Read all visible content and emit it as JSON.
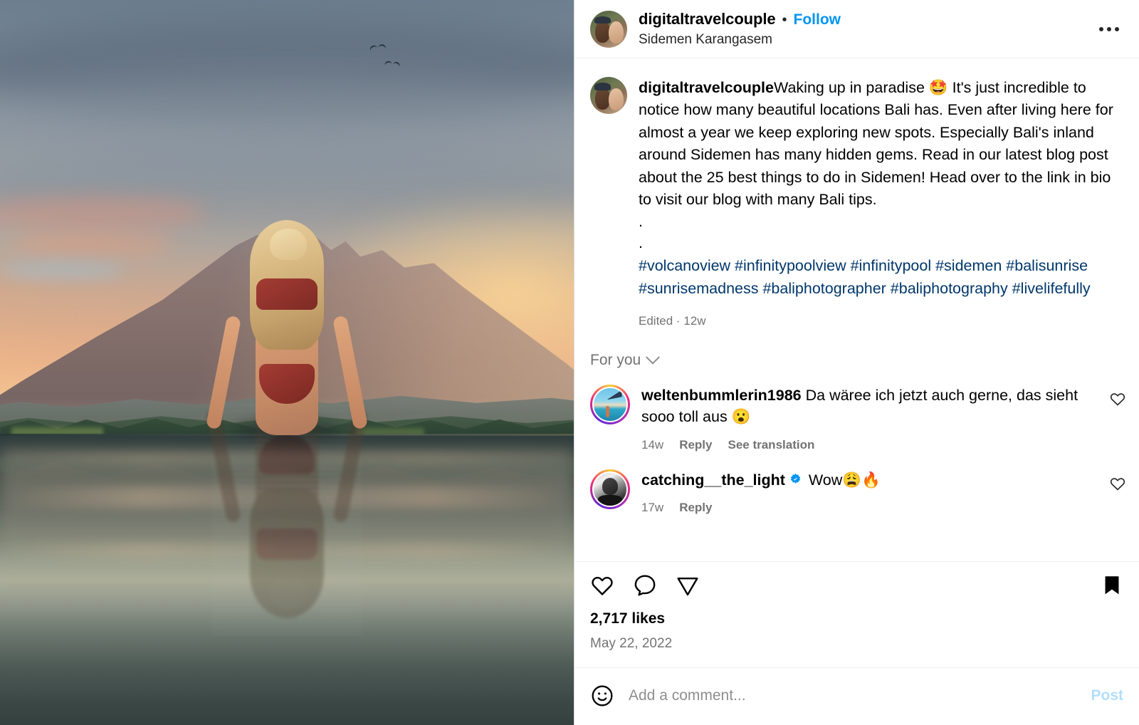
{
  "header": {
    "username": "digitaltravelcouple",
    "separator": "•",
    "follow_label": "Follow",
    "location": "Sidemen Karangasem",
    "more_icon": "ellipsis-icon",
    "avatar_alt": "digitaltravelcouple-avatar"
  },
  "caption": {
    "username": "digitaltravelcouple",
    "body": "Waking up in paradise 🤩 It's just incredible to notice how many beautiful locations Bali has. Even after living here for almost a year we keep exploring new spots. Especially Bali's inland around Sidemen has many hidden gems. Read in our latest blog post about the 25 best things to do in Sidemen! Head over to the link in bio to visit our blog with many Bali tips.",
    "dot_line_1": ".",
    "dot_line_2": ".",
    "hashtags": "#volcanoview #infinitypoolview #infinitypool #sidemen #balisunrise #sunrisemadness #baliphotographer #baliphotography #livelifefully",
    "edited_meta": "Edited · 12w"
  },
  "comments_filter": {
    "label": "For you",
    "chevron_icon": "chevron-down-icon"
  },
  "comments": [
    {
      "username": "weltenbummlerin1986",
      "verified": false,
      "text": " Da wäree ich jetzt auch gerne, das sieht sooo toll aus 😮",
      "time": "14w",
      "reply_label": "Reply",
      "translate_label": "See translation",
      "like_icon": "heart-outline-icon",
      "avatar_alt": "weltenbummlerin1986-avatar"
    },
    {
      "username": "catching__the_light",
      "verified": true,
      "text": " Wow😩🔥",
      "time": "17w",
      "reply_label": "Reply",
      "translate_label": "",
      "like_icon": "heart-outline-icon",
      "avatar_alt": "catching__the_light-avatar"
    }
  ],
  "actions": {
    "like_icon": "heart-outline-icon",
    "comment_icon": "comment-bubble-icon",
    "share_icon": "share-paper-plane-icon",
    "save_icon": "bookmark-filled-icon",
    "likes": "2,717 likes",
    "date": "May 22, 2022"
  },
  "add_comment": {
    "emoji_icon": "emoji-smiley-icon",
    "placeholder": "Add a comment...",
    "value": "",
    "post_label": "Post"
  },
  "media": {
    "alt": "woman-in-infinity-pool-with-volcano-at-sunrise"
  },
  "colors": {
    "link_blue": "#0095f6",
    "hashtag_blue": "#00376b",
    "muted_gray": "#737373",
    "post_disabled": "#b2dffc",
    "verified_blue": "#0095f6"
  }
}
